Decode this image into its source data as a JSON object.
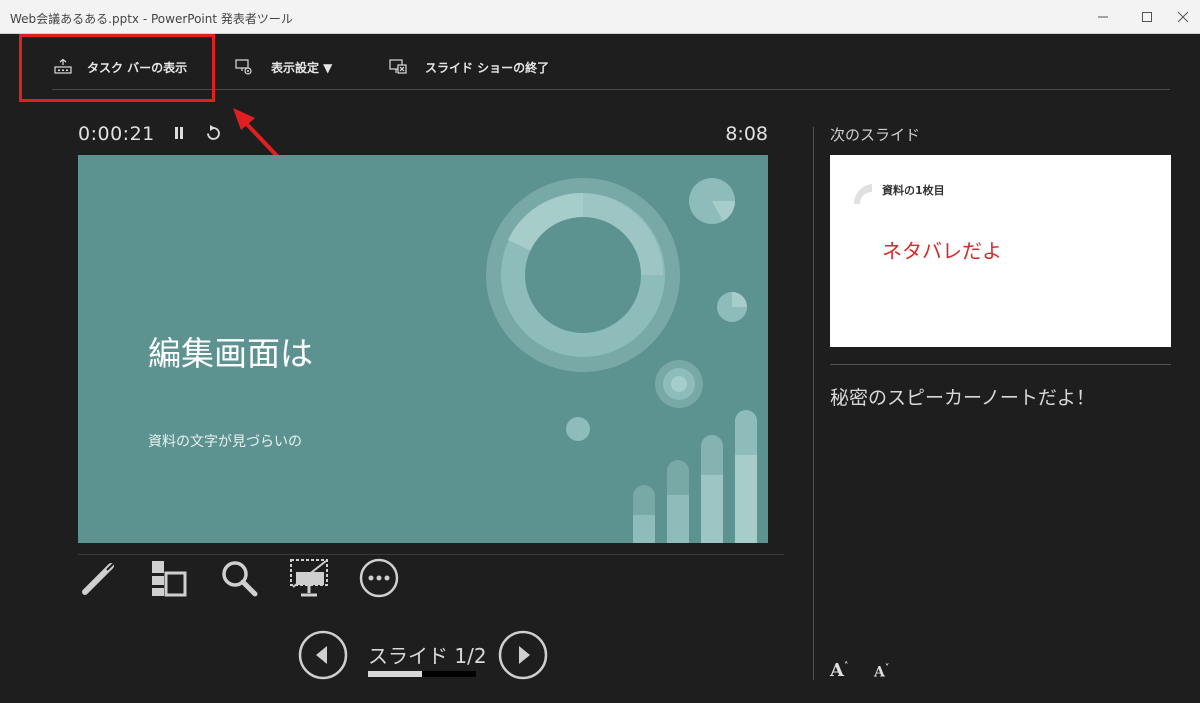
{
  "window": {
    "title": "Web会議あるある.pptx - PowerPoint 発表者ツール"
  },
  "toolbar": {
    "taskbar_label": "タスク バーの表示",
    "display_settings_label": "表示設定 ▼",
    "end_show_label": "スライド ショーの終了"
  },
  "timer": {
    "elapsed": "0:00:21",
    "clock": "8:08"
  },
  "current_slide": {
    "title": "編集画面は",
    "subtitle": "資料の文字が見づらいの"
  },
  "navigation": {
    "counter": "スライド 1/2",
    "progress": 0.5
  },
  "next_pane": {
    "label": "次のスライド",
    "slide_title": "資料の1枚目",
    "slide_body": "ネタバレだよ"
  },
  "notes": {
    "text": "秘密のスピーカーノートだよ！"
  },
  "font_controls": {
    "increase": "A",
    "decrease": "A"
  },
  "colors": {
    "slide_background": "#5c9391",
    "highlight": "#e02020",
    "next_slide_body": "#d62b2b"
  },
  "icons": [
    "taskbar-icon",
    "display-settings-icon",
    "end-show-icon",
    "pause-icon",
    "reset-icon",
    "pen-icon",
    "all-slides-icon",
    "zoom-icon",
    "black-screen-icon",
    "more-icon",
    "previous-icon",
    "next-icon",
    "minimize-icon",
    "maximize-icon",
    "close-icon"
  ]
}
